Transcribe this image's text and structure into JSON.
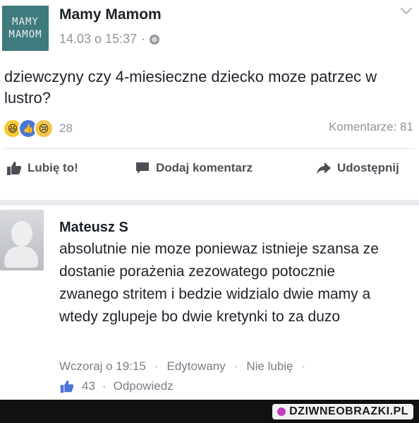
{
  "post": {
    "logo_line1": "MAMY",
    "logo_line2": "MAMOM",
    "page_name": "Mamy Mamom",
    "timestamp": "14.03 o 15:37",
    "separator": "·",
    "text": "dziewczyny czy 4-miesieczne dziecko moze patrzec w lustro?",
    "reactions": {
      "icons": [
        "haha-icon",
        "like-icon",
        "sad-icon"
      ],
      "count": "28"
    },
    "comments_count": "Komentarze: 81",
    "actions": {
      "like": "Lubię to!",
      "comment": "Dodaj komentarz",
      "share": "Udostępnij"
    }
  },
  "comment": {
    "author": "Mateusz S",
    "text": "absolutnie nie moze poniewaz istnieje szansa ze dostanie porażenia zezowatego potocznie zwanego stritem i bedzie widzialo dwie mamy a wtedy zglupeje bo dwie kretynki to za duzo",
    "time": "Wczoraj o 19:15",
    "edited": "Edytowany",
    "unlike": "Nie lubię",
    "likes": "43",
    "reply": "Odpowiedz",
    "dot": "·"
  },
  "footer": {
    "watermark": "DZIWNEOBRAZKI.PL"
  },
  "colors": {
    "link_blue": "#4b76d6",
    "meta_gray": "#90949c",
    "text": "#1d2129",
    "logo_bg": "#3f7a7d"
  }
}
